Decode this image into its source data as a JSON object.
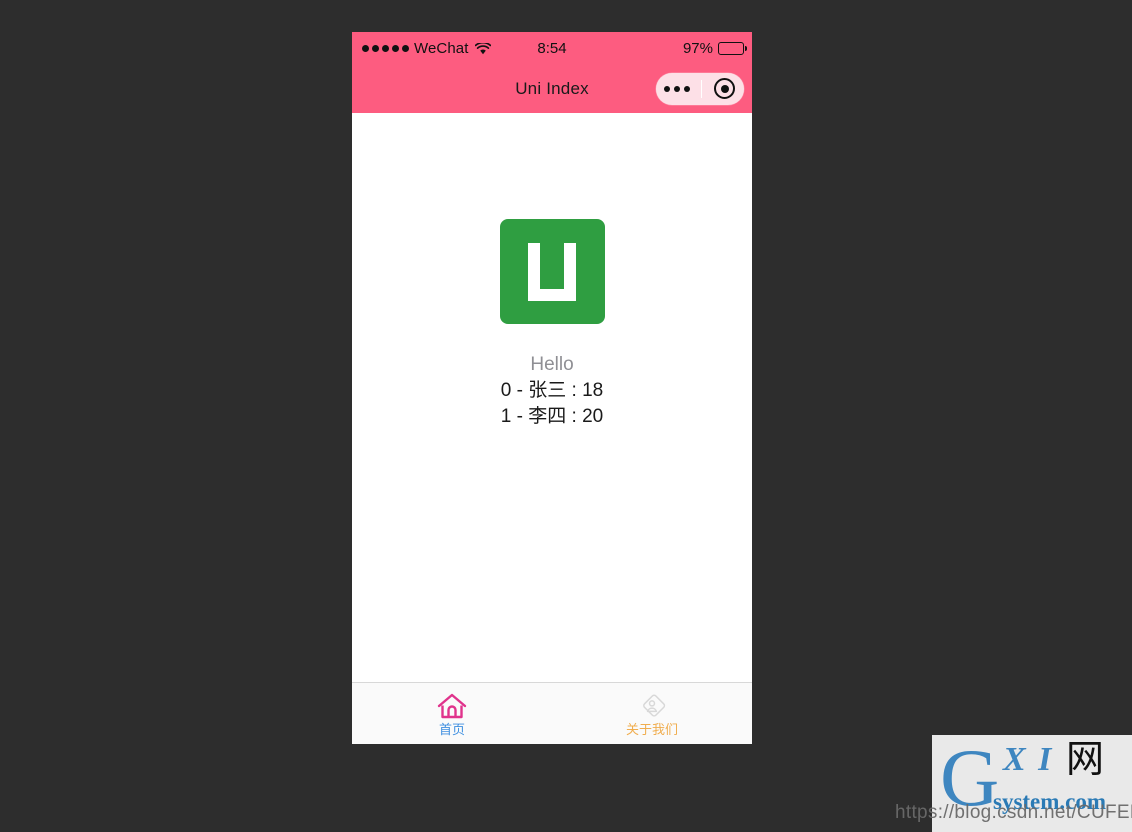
{
  "phone": {
    "status_bar": {
      "carrier": "WeChat",
      "signal_dots": 5,
      "wifi_icon": "wifi-icon",
      "time": "8:54",
      "battery_percent": "97%",
      "battery_icon": "battery-full-icon"
    },
    "nav_bar": {
      "title": "Uni Index",
      "capsule": {
        "menu_icon": "more-dots-icon",
        "close_icon": "target-circle-icon"
      }
    },
    "content": {
      "logo": {
        "icon": "uni-app-logo-icon",
        "letter": "U",
        "bg_color": "#2f9e41"
      },
      "hello": "Hello",
      "items": [
        "0 - 张三 : 18",
        "1 - 李四 : 20"
      ]
    },
    "tab_bar": {
      "tabs": [
        {
          "label": "首页",
          "icon": "home-icon",
          "color": "#3f8fe0",
          "icon_color": "#e0338c",
          "active": true
        },
        {
          "label": "关于我们",
          "icon": "about-person-diamond-icon",
          "color": "#f0ad4e",
          "icon_color": "#d6d6d6",
          "active": false
        }
      ]
    }
  },
  "watermark": {
    "logo_g": "G",
    "logo_xi": "X I",
    "logo_wang": "网",
    "logo_system": "system.com",
    "url": "https://blog.csdn.net/CUFEECR"
  },
  "theme": {
    "header_pink": "#fd5c80",
    "capsule_pink": "#fde0e7",
    "page_bg": "#2d2d2d",
    "logo_green": "#2f9e41",
    "hello_gray": "#8f8f94"
  }
}
